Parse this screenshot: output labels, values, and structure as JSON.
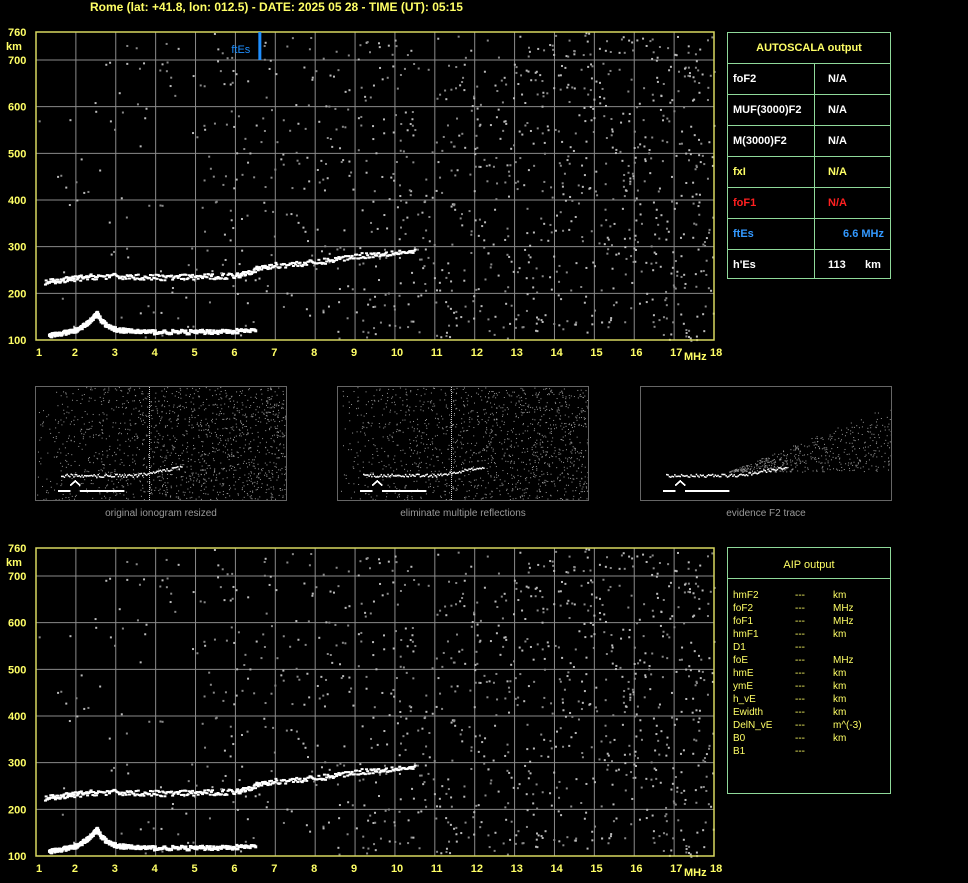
{
  "header": "Rome (lat: +41.8, lon: 012.5) - DATE: 2025 05 28 - TIME (UT): 05:15",
  "plot": {
    "y_ticks": [
      "760",
      "700",
      "600",
      "500",
      "400",
      "300",
      "200",
      "100"
    ],
    "y_unit": "km",
    "x_ticks": [
      "1",
      "2",
      "3",
      "4",
      "5",
      "6",
      "7",
      "8",
      "9",
      "10",
      "11",
      "12",
      "13",
      "14",
      "15",
      "16",
      "17",
      "18"
    ],
    "x_unit": "MHz",
    "marker_label": "ftEs",
    "colors": {
      "frame": "#d8d860",
      "grid": "#8a8a8a",
      "marker": "#1f8fff",
      "axis_text": "#ffff66"
    }
  },
  "chart_data": [
    {
      "type": "scatter",
      "title": "Rome (lat: +41.8, lon: 012.5) - DATE: 2025 05 28 - TIME (UT): 05:15",
      "xlabel": "MHz",
      "ylabel": "km",
      "xlim": [
        1,
        18
      ],
      "ylim": [
        100,
        760
      ],
      "grid": true,
      "x_ticks": [
        1,
        2,
        3,
        4,
        5,
        6,
        7,
        8,
        9,
        10,
        11,
        12,
        13,
        14,
        15,
        16,
        17,
        18
      ],
      "y_ticks": [
        100,
        200,
        300,
        400,
        500,
        600,
        700,
        760
      ],
      "marker": {
        "label": "ftEs",
        "x": 6.6,
        "y_range": [
          700,
          760
        ]
      },
      "series": [
        {
          "name": "",
          "x": [
            1.3,
            1.5,
            1.8,
            2.0,
            2.2,
            2.4,
            2.5,
            2.6,
            2.8,
            3.0,
            3.3,
            3.6,
            4.0,
            4.5,
            5.0,
            5.5,
            6.0,
            6.5
          ],
          "y": [
            113,
            115,
            120,
            125,
            135,
            150,
            160,
            145,
            130,
            125,
            122,
            121,
            120,
            120,
            120,
            121,
            122,
            123
          ]
        },
        {
          "name": "",
          "x": [
            1.2,
            1.5,
            1.8,
            2.1,
            2.5,
            3.0,
            3.5,
            4.0,
            4.5,
            5.0,
            5.5,
            6.0,
            6.3,
            6.6,
            7.0,
            7.5,
            8.0,
            8.5,
            9.0,
            9.5,
            10.0,
            10.5
          ],
          "y": [
            225,
            228,
            232,
            235,
            238,
            238,
            237,
            236,
            236,
            237,
            238,
            240,
            248,
            256,
            262,
            265,
            268,
            275,
            282,
            285,
            290,
            290
          ]
        }
      ]
    },
    {
      "type": "scatter",
      "title": "",
      "xlabel": "MHz",
      "ylabel": "km",
      "xlim": [
        1,
        18
      ],
      "ylim": [
        100,
        760
      ],
      "grid": true,
      "x_ticks": [
        1,
        2,
        3,
        4,
        5,
        6,
        7,
        8,
        9,
        10,
        11,
        12,
        13,
        14,
        15,
        16,
        17,
        18
      ],
      "y_ticks": [
        100,
        200,
        300,
        400,
        500,
        600,
        700,
        760
      ],
      "series": [
        {
          "name": "",
          "x": [
            1.3,
            1.5,
            1.8,
            2.0,
            2.2,
            2.4,
            2.5,
            2.6,
            2.8,
            3.0,
            3.3,
            3.6,
            4.0,
            4.5,
            5.0,
            5.5,
            6.0,
            6.5
          ],
          "y": [
            113,
            115,
            120,
            125,
            135,
            150,
            160,
            145,
            130,
            125,
            122,
            121,
            120,
            120,
            120,
            121,
            122,
            123
          ]
        },
        {
          "name": "",
          "x": [
            1.2,
            1.5,
            1.8,
            2.1,
            2.5,
            3.0,
            3.5,
            4.0,
            4.5,
            5.0,
            5.5,
            6.0,
            6.3,
            6.6,
            7.0,
            7.5,
            8.0,
            8.5,
            9.0,
            9.5,
            10.0,
            10.5
          ],
          "y": [
            225,
            228,
            232,
            235,
            238,
            238,
            237,
            236,
            236,
            237,
            238,
            240,
            248,
            256,
            262,
            265,
            268,
            275,
            282,
            285,
            290,
            290
          ]
        }
      ]
    }
  ],
  "autoscala": {
    "title": "AUTOSCALA output",
    "rows": [
      {
        "label": "foF2",
        "value": "N/A",
        "color": "#ffffff"
      },
      {
        "label": "MUF(3000)F2",
        "value": "N/A",
        "color": "#ffffff"
      },
      {
        "label": "M(3000)F2",
        "value": "N/A",
        "color": "#ffffff"
      },
      {
        "label": "fxI",
        "value": "N/A",
        "color": "#ffff66"
      },
      {
        "label": "foF1",
        "value": "N/A",
        "color": "#ff2020"
      },
      {
        "label": "ftEs",
        "value": "6.6  MHz",
        "color": "#3399ff"
      },
      {
        "label": "h'Es",
        "value": "113",
        "unit": "km",
        "color": "#ffffff"
      }
    ]
  },
  "thumbnails": [
    {
      "caption": "original ionogram resized"
    },
    {
      "caption": "eliminate multiple reflections"
    },
    {
      "caption": "evidence F2 trace"
    }
  ],
  "aip": {
    "title": "AIP output",
    "rows": [
      {
        "label": "hmF2",
        "value": "---",
        "unit": "km"
      },
      {
        "label": "foF2",
        "value": "---",
        "unit": "MHz"
      },
      {
        "label": "foF1",
        "value": "---",
        "unit": "MHz"
      },
      {
        "label": "hmF1",
        "value": "---",
        "unit": "km"
      },
      {
        "label": "D1",
        "value": "---",
        "unit": ""
      },
      {
        "label": "foE",
        "value": "---",
        "unit": "MHz"
      },
      {
        "label": "hmE",
        "value": "---",
        "unit": "km"
      },
      {
        "label": "ymE",
        "value": "---",
        "unit": "km"
      },
      {
        "label": "h_vE",
        "value": "---",
        "unit": "km"
      },
      {
        "label": "Ewidth",
        "value": "---",
        "unit": "km"
      },
      {
        "label": "DelN_vE",
        "value": "---",
        "unit": "m^(-3)"
      },
      {
        "label": "B0",
        "value": "---",
        "unit": "km"
      },
      {
        "label": "B1",
        "value": "---",
        "unit": ""
      }
    ]
  }
}
